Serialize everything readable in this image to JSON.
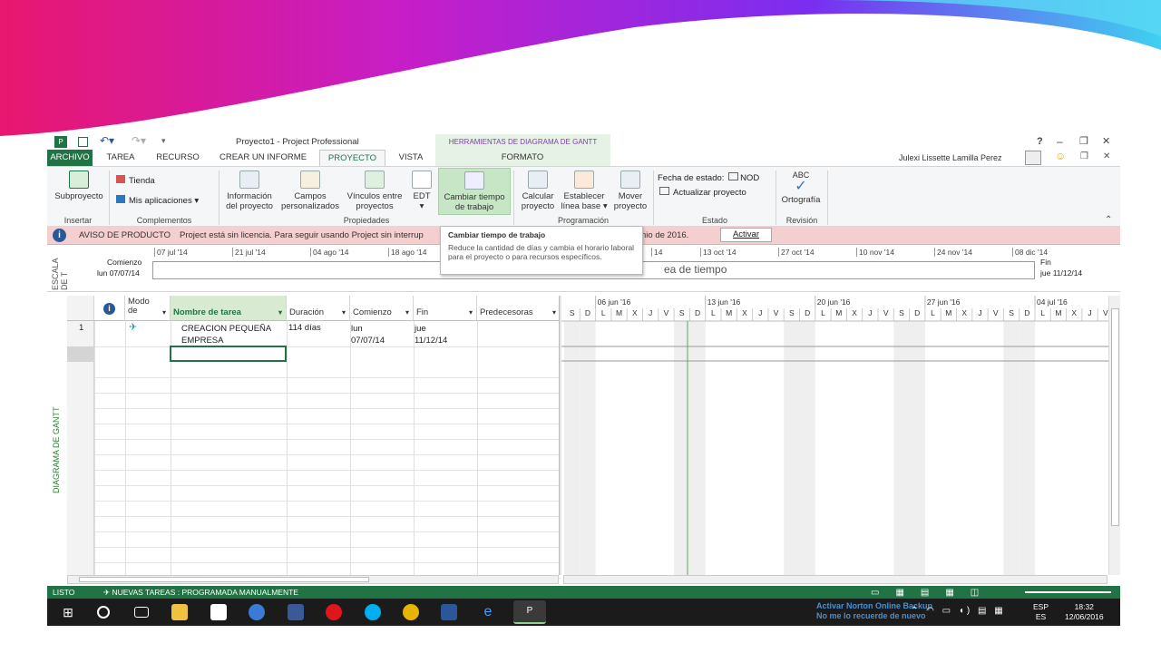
{
  "window": {
    "title": "Proyecto1 - Project Professional",
    "context_header": "HERRAMIENTAS DE DIAGRAMA DE GANTT",
    "help": "?",
    "minimize": "–",
    "restore": "❐",
    "close": "✕",
    "user": "Julexi Lissette Lamilla Perez"
  },
  "tabs": [
    "ARCHIVO",
    "TAREA",
    "RECURSO",
    "CREAR UN INFORME",
    "PROYECTO",
    "VISTA",
    "FORMATO"
  ],
  "ribbon": {
    "subproyecto": "Subproyecto",
    "tienda": "Tienda",
    "mis_aplicaciones": "Mis aplicaciones",
    "info_proyecto_1": "Información",
    "info_proyecto_2": "del proyecto",
    "campos_1": "Campos",
    "campos_2": "personalizados",
    "vinculos_1": "Vínculos entre",
    "vinculos_2": "proyectos",
    "edt": "EDT",
    "cambiar_1": "Cambiar tiempo",
    "cambiar_2": "de trabajo",
    "calcular_1": "Calcular",
    "calcular_2": "proyecto",
    "establecer_1": "Establecer",
    "establecer_2": "línea base",
    "mover_1": "Mover",
    "mover_2": "proyecto",
    "fecha_estado": "Fecha de estado:",
    "fecha_valor": "NOD",
    "actualizar": "Actualizar proyecto",
    "ortografia": "Ortografía",
    "abc": "ABC",
    "groups": [
      "Insertar",
      "Complementos",
      "Propiedades",
      "Programación",
      "Estado",
      "Revisión"
    ]
  },
  "notice": {
    "label": "AVISO DE PRODUCTO",
    "text_left": "Project está sin licencia. Para seguir usando Project sin interrup",
    "text_right": "nio de 2016.",
    "activate": "Activar"
  },
  "tooltip": {
    "title": "Cambiar tiempo de trabajo",
    "body": "Reduce la cantidad de días y cambia el horario laboral para el proyecto o para recursos específicos."
  },
  "timeline": {
    "side_label": "ESCALA DE T",
    "start_label": "Comienzo",
    "start_date": "lun 07/07/14",
    "end_label": "Fin",
    "end_date": "jue 11/12/14",
    "center_text": "ea de tiempo",
    "dates": [
      "07 jul '14",
      "21 jul '14",
      "04 ago '14",
      "18 ago '14",
      "14",
      "13 oct '14",
      "27 oct '14",
      "10 nov '14",
      "24 nov '14",
      "08 dic '14"
    ]
  },
  "grid": {
    "side_label": "DIAGRAMA DE GANTT",
    "headers": [
      "Modo de",
      "Nombre de tarea",
      "Duración",
      "Comienzo",
      "Fin",
      "Predecesoras"
    ],
    "rows": [
      {
        "id": "1",
        "name": "CREACION PEQUEÑA EMPRESA",
        "duration": "114 días",
        "start_1": "lun",
        "start_2": "07/07/14",
        "end_1": "jue",
        "end_2": "11/12/14"
      }
    ]
  },
  "gantt": {
    "weeks": [
      "06 jun '16",
      "13 jun '16",
      "20 jun '16",
      "27 jun '16",
      "04 jul '16"
    ],
    "days": [
      "S",
      "D",
      "L",
      "M",
      "X",
      "J",
      "V",
      "S",
      "D",
      "L",
      "M",
      "X",
      "J",
      "V",
      "S",
      "D",
      "L",
      "M",
      "X",
      "J",
      "V",
      "S",
      "D",
      "L",
      "M",
      "X",
      "J",
      "V",
      "S",
      "D",
      "L",
      "M",
      "X",
      "J",
      "V"
    ]
  },
  "status": {
    "ready": "LISTO",
    "new_tasks": "NUEVAS TAREAS : PROGRAMADA MANUALMENTE"
  },
  "taskbar": {
    "norton_1": "Activar Norton Online Backup",
    "norton_2": "No me lo recuerde de nuevo",
    "lang_1": "ESP",
    "lang_2": "ES",
    "time": "18:32",
    "date": "12/06/2016"
  },
  "colors": {
    "brand": "#217346",
    "notice": "#f3cfcf",
    "context": "#7a3fa0"
  }
}
